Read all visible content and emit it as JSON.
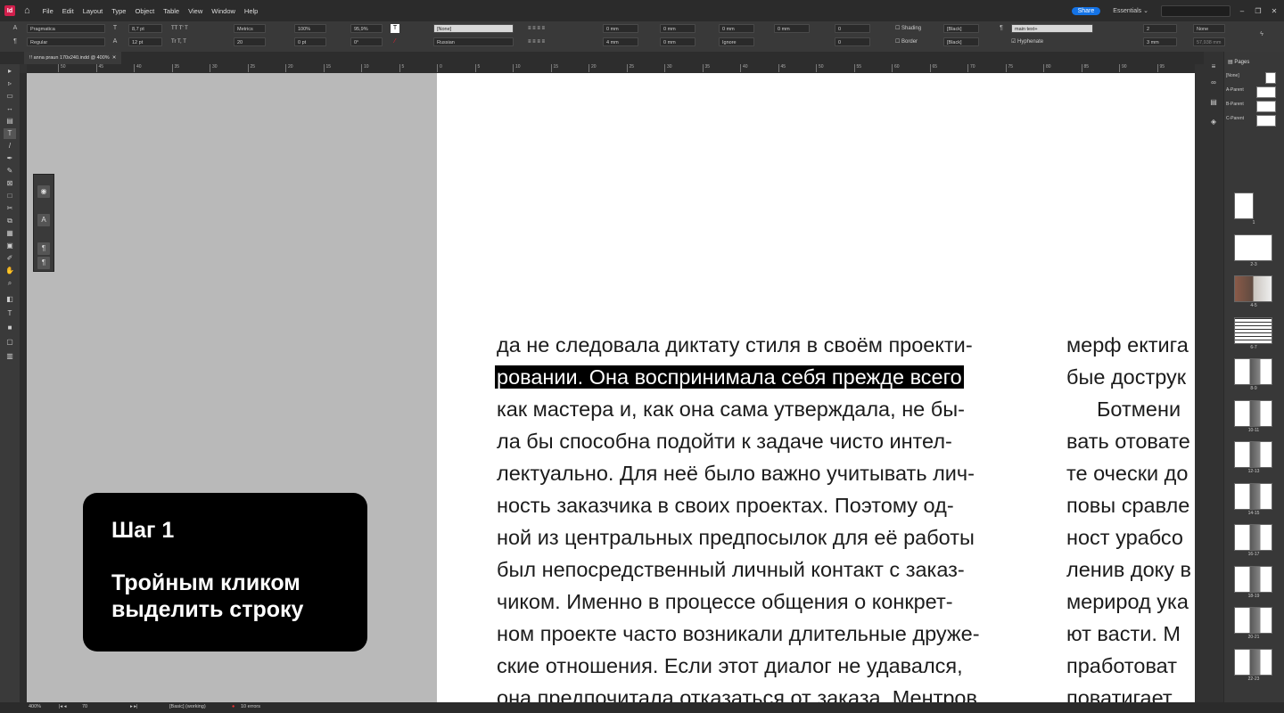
{
  "app": {
    "logo": "Id",
    "menu": [
      "File",
      "Edit",
      "Layout",
      "Type",
      "Object",
      "Table",
      "View",
      "Window",
      "Help"
    ],
    "share": "Share",
    "workspace": "Essentials"
  },
  "control": {
    "font": "Pragmatica",
    "style": "Regular",
    "size": "8,7 pt",
    "leading": "12 pt",
    "kerning": "Metrics",
    "tracking": "20",
    "vscale": "100%",
    "hscale": "95,9%",
    "baseline": "0 pt",
    "skew": "0°",
    "char_style": "[None]",
    "language": "Russian",
    "indent1": "0 mm",
    "indent2": "0 mm",
    "indent3": "0 mm",
    "indent4": "0 mm",
    "space1": "4 mm",
    "space2": "0 mm",
    "ignore": "Ignore",
    "num1": "0",
    "num2": "0",
    "shading": "Shading",
    "border": "Border",
    "swatch1": "[Black]",
    "swatch2": "[Black]",
    "para_style": "main text+",
    "hyphenate": "Hyphenate",
    "cols": "2",
    "gutter": "3 mm",
    "colsval": "None",
    "width": "57,938 mm"
  },
  "document": {
    "tab": "!! anna praun 170x240.indd @ 400%"
  },
  "ruler": {
    "ticks": [
      "50",
      "45",
      "40",
      "35",
      "30",
      "25",
      "20",
      "15",
      "10",
      "5",
      "0",
      "5",
      "10",
      "15",
      "20",
      "25",
      "30",
      "35",
      "40",
      "45",
      "50",
      "55",
      "60",
      "65",
      "70",
      "75",
      "80",
      "85",
      "90",
      "95"
    ]
  },
  "text_left": [
    "да не следовала диктату стиля в своём проекти-",
    "ровании. Она воспринимала себя прежде всего",
    "как мастера и, как она сама утверждала, не бы-",
    "ла бы способна подойти к задаче чисто интел-",
    "лектуально. Для неё было важно учитывать лич-",
    "ность заказчика в своих проектах. Поэтому од-",
    "ной из центральных предпосылок для её работы",
    "был непосредственный личный контакт с заказ-",
    "чиком. Именно в процессе общения о конкрет-",
    "ном проекте часто возникали длительные друже-",
    "ские отношения. Если этот диалог не удавался,",
    "она предпочитала отказаться от заказа. Ментров"
  ],
  "text_right": [
    "мерф ектига",
    "бые дострук",
    "Ботмени",
    "вать отовате",
    "те очески до",
    "повы сравле",
    "ност урабсо",
    "ленив доку в",
    "мерирод ука",
    "ют васти. М",
    "пработоват",
    "поватигает"
  ],
  "callout": {
    "step": "Шаг 1",
    "instruction": "Тройным кликом выделить строку"
  },
  "pages_panel": {
    "title": "Pages",
    "parents": [
      "[None]",
      "A-Parent",
      "B-Parent",
      "C-Parent"
    ],
    "page_labels": [
      "1",
      "2-3",
      "4-5",
      "6-7",
      "8-9",
      "10-11",
      "12-13",
      "14-15",
      "16-17",
      "18-19",
      "20-21",
      "22-23"
    ]
  },
  "status": {
    "zoom": "400%",
    "page": "70",
    "profile": "[Basic] (working)",
    "errors": "10 errors"
  }
}
